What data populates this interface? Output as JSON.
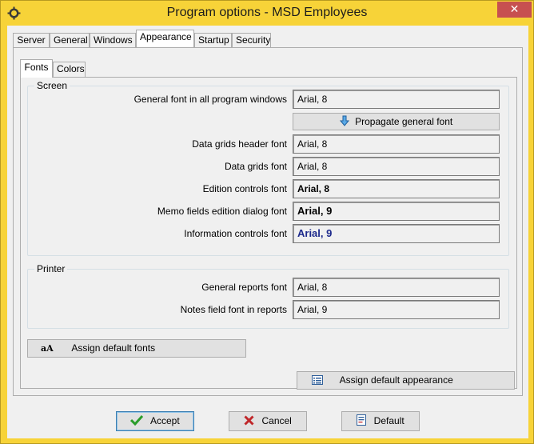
{
  "window": {
    "title": "Program options - MSD Employees",
    "close_glyph": "✕"
  },
  "tabs": [
    {
      "label": "Server",
      "active": false
    },
    {
      "label": "General",
      "active": false
    },
    {
      "label": "Windows",
      "active": false
    },
    {
      "label": "Appearance",
      "active": true
    },
    {
      "label": "Startup",
      "active": false
    },
    {
      "label": "Security",
      "active": false
    }
  ],
  "subtabs": [
    {
      "label": "Fonts",
      "active": true
    },
    {
      "label": "Colors",
      "active": false
    }
  ],
  "screen_group": {
    "label": "Screen",
    "rows": [
      {
        "label": "General font in all program windows",
        "value": "Arial, 8"
      },
      {
        "label": "Data grids header font",
        "value": "Arial, 8"
      },
      {
        "label": "Data grids font",
        "value": "Arial, 8"
      },
      {
        "label": "Edition controls font",
        "value": "Arial, 8"
      },
      {
        "label": "Memo fields edition dialog font",
        "value": "Arial, 9"
      },
      {
        "label": "Information controls font",
        "value": "Arial, 9"
      }
    ],
    "propagate_label": "Propagate general font"
  },
  "printer_group": {
    "label": "Printer",
    "rows": [
      {
        "label": "General reports font",
        "value": "Arial, 8"
      },
      {
        "label": "Notes field font in reports",
        "value": "Arial, 9"
      }
    ]
  },
  "buttons": {
    "assign_default_fonts": "Assign default fonts",
    "assign_default_appearance": "Assign default appearance",
    "accept": "Accept",
    "cancel": "Cancel",
    "default": "Default"
  },
  "colors": {
    "titlebar": "#f7d338",
    "info_font": "#1d2a8c",
    "accept_check": "#2a9d2a",
    "cancel_x": "#c0282b"
  }
}
